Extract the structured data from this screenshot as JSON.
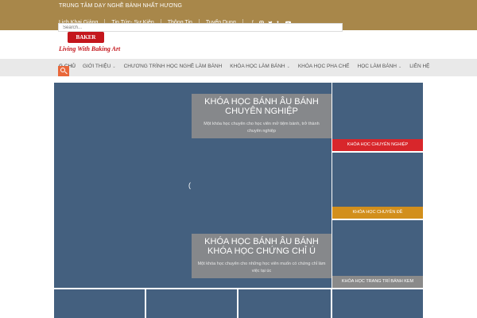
{
  "topbar": {
    "tagline": "TRUNG TÂM DẠY NGHỀ BÁNH NHẤT HƯƠNG",
    "links": [
      "Lịch Khai Giảng",
      "Tin Tức- Sự Kiện",
      "Thông Tin",
      "Tuyển Dụng"
    ],
    "social_icons": [
      "facebook-icon",
      "instagram-icon",
      "twitter-icon",
      "phone-icon",
      "youtube-icon"
    ]
  },
  "header": {
    "logo_text": "BAKER LOVE",
    "slogan": "Living With Baking Art",
    "search_placeholder": "Search..."
  },
  "nav": {
    "items": [
      {
        "label": "G CHỦ",
        "has_dropdown": false
      },
      {
        "label": "GIỚI THIỆU",
        "has_dropdown": true
      },
      {
        "label": "CHƯƠNG TRÌNH HỌC NGHỀ LÀM BÁNH",
        "has_dropdown": false
      },
      {
        "label": "KHÓA HỌC LÀM BÁNH",
        "has_dropdown": true
      },
      {
        "label": "KHÓA HỌC PHA CHẾ",
        "has_dropdown": false
      },
      {
        "label": "HỌC LÀM BÁNH",
        "has_dropdown": true
      },
      {
        "label": "LIÊN HỆ",
        "has_dropdown": false
      }
    ]
  },
  "slider": {
    "loader": "(",
    "captions": [
      {
        "title_line1": "KHÓA HỌC BÁNH ÂU BÁNH",
        "title_line2": "CHUYÊN NGHIỆP",
        "text": "Một khóa học chuyên cho học viên mở tiệm bánh, trở thành chuyên nghiệp"
      },
      {
        "title_line1": "KHÓA HỌC BÁNH ÂU BÁNH",
        "title_line2": "KHÓA HỌC CHỨNG CHỈ Ú",
        "text": "Một khóa học chuyên cho những học viên muốn có chứng chỉ làm việc tại úc"
      }
    ]
  },
  "cards": [
    {
      "label": "KHÓA HỌC CHUYÊN NGHIỆP",
      "color": "#d8262b"
    },
    {
      "label": "KHÓA HỌC CHUYÊN ĐỀ",
      "color": "#d28f1c"
    },
    {
      "label": "KHÓA HỌC TRANG TRÍ BÁNH KEM",
      "color": "#8a8a8a"
    }
  ],
  "colors": {
    "topbar": "#a8874a",
    "brand_red": "#c4161c",
    "tile_blue": "#44607f",
    "search_button": "#e8673a"
  }
}
